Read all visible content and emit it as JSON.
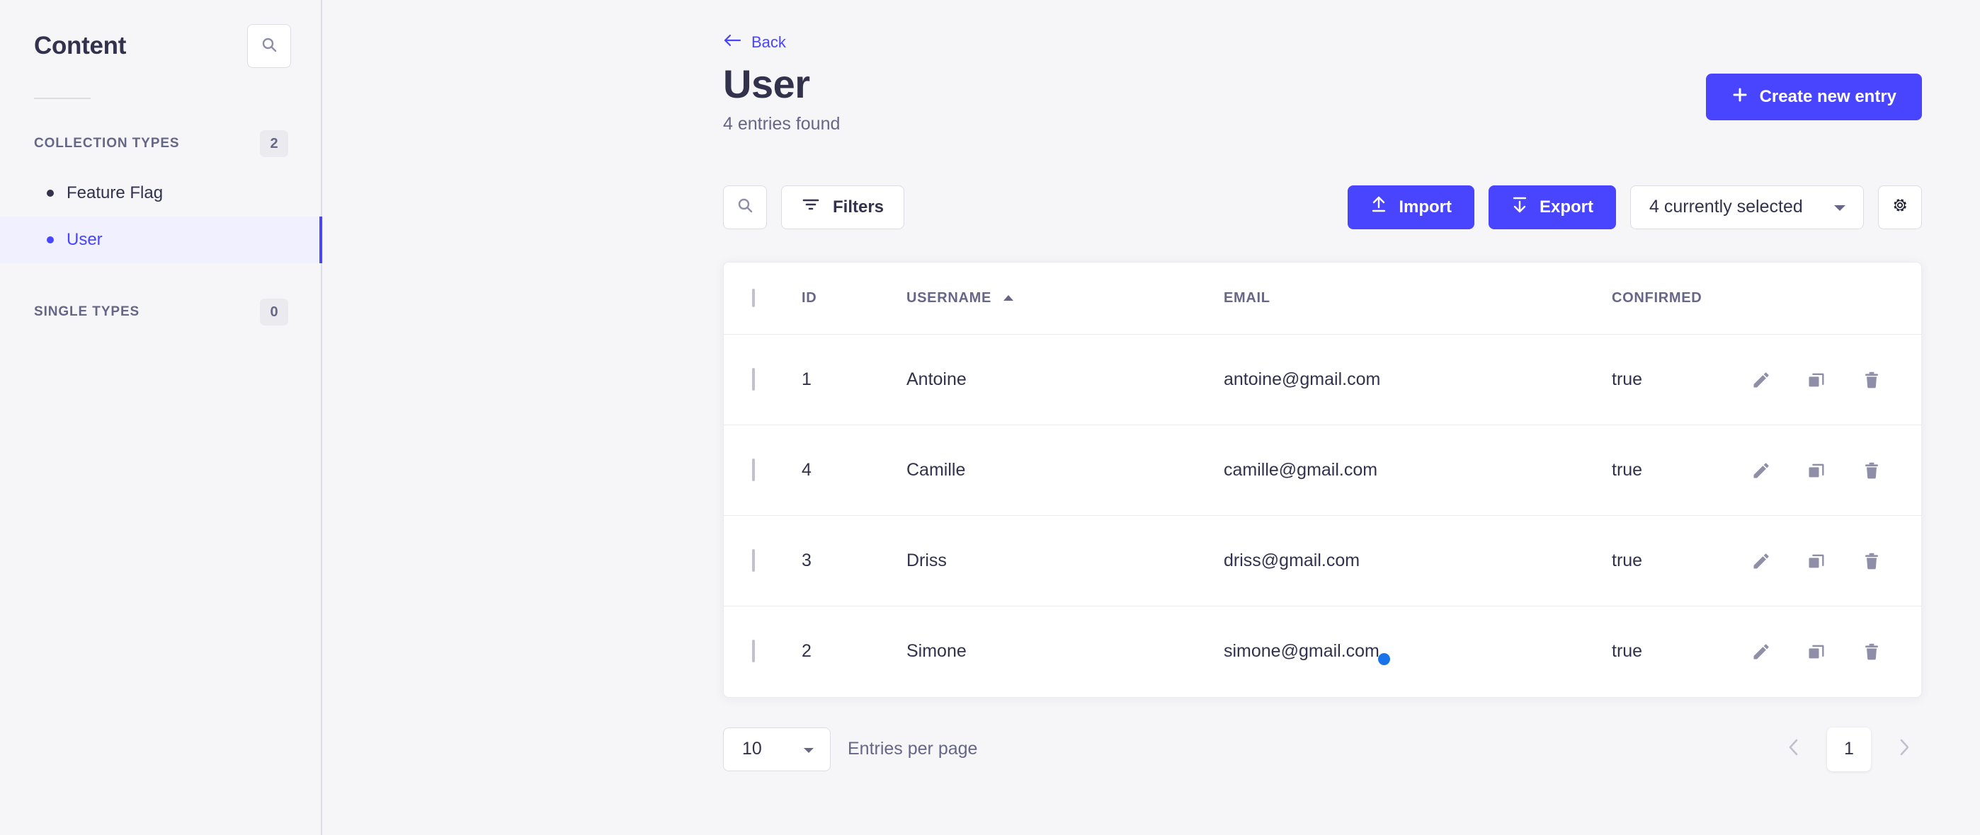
{
  "colors": {
    "brand": "#4945ff",
    "text": "#32324d",
    "muted": "#666687",
    "page_bg": "#f6f6f9",
    "card_bg": "#ffffff",
    "border": "#dcdce4",
    "active_bg": "#f0f0ff",
    "cursor_dot": "#1a73e8"
  },
  "sidebar": {
    "title": "Content",
    "search_icon": "search-icon",
    "groups": [
      {
        "label": "COLLECTION TYPES",
        "count": "2",
        "items": [
          {
            "label": "Feature Flag",
            "active": false
          },
          {
            "label": "User",
            "active": true
          }
        ]
      },
      {
        "label": "SINGLE TYPES",
        "count": "0",
        "items": []
      }
    ]
  },
  "header": {
    "back_label": "Back",
    "back_icon": "arrow-left-icon",
    "title": "User",
    "subtitle": "4 entries found",
    "create_label": "Create new entry",
    "create_icon": "plus-icon"
  },
  "toolbar": {
    "search_icon": "search-icon",
    "filters_label": "Filters",
    "filters_icon": "filter-icon",
    "import_label": "Import",
    "import_icon": "upload-icon",
    "export_label": "Export",
    "export_icon": "download-icon",
    "selected_label": "4 currently selected",
    "selected_chevron": "chevron-down-icon",
    "settings_icon": "gear-icon"
  },
  "table": {
    "columns": [
      {
        "key": "checkbox",
        "label": ""
      },
      {
        "key": "id",
        "label": "ID"
      },
      {
        "key": "username",
        "label": "USERNAME",
        "sorted": "asc",
        "sort_icon": "caret-up-icon"
      },
      {
        "key": "email",
        "label": "EMAIL"
      },
      {
        "key": "confirmed",
        "label": "CONFIRMED"
      }
    ],
    "row_actions": [
      {
        "name": "edit-icon",
        "title": "Edit"
      },
      {
        "name": "duplicate-icon",
        "title": "Duplicate"
      },
      {
        "name": "delete-icon",
        "title": "Delete"
      }
    ],
    "rows": [
      {
        "id": "1",
        "username": "Antoine",
        "email": "antoine@gmail.com",
        "confirmed": "true",
        "checked": false
      },
      {
        "id": "4",
        "username": "Camille",
        "email": "camille@gmail.com",
        "confirmed": "true",
        "checked": false
      },
      {
        "id": "3",
        "username": "Driss",
        "email": "driss@gmail.com",
        "confirmed": "true",
        "checked": false
      },
      {
        "id": "2",
        "username": "Simone",
        "email": "simone@gmail.com",
        "confirmed": "true",
        "checked": false
      }
    ]
  },
  "footer": {
    "per_page_value": "10",
    "per_page_label": "Entries per page",
    "prev_icon": "chevron-left-icon",
    "next_icon": "chevron-right-icon",
    "current_page": "1"
  }
}
